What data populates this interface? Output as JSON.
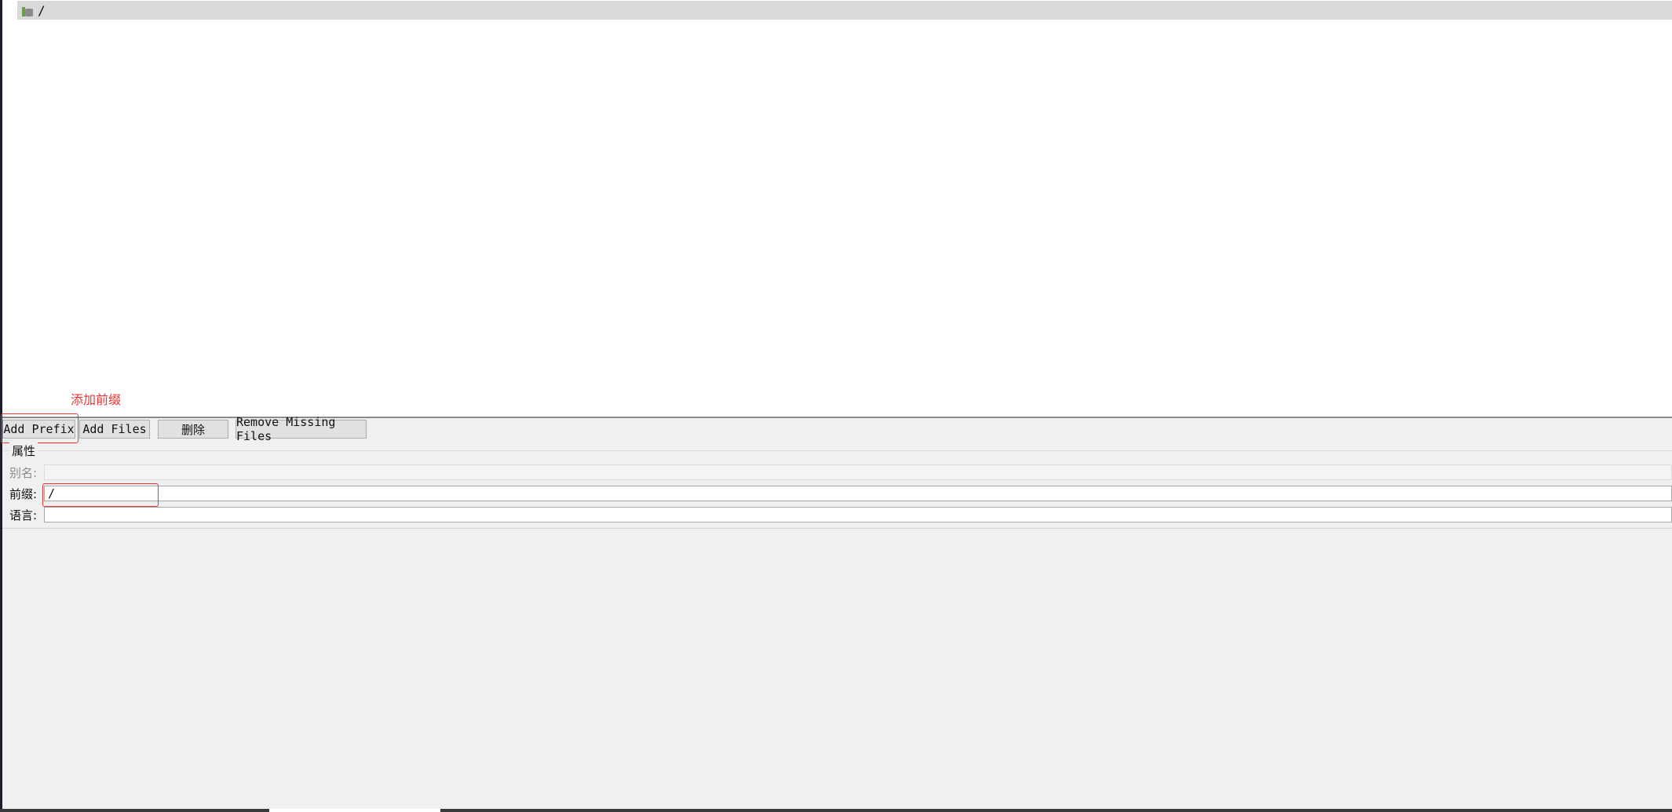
{
  "tree": {
    "root_label": "/",
    "root_icon": "resource-folder-icon"
  },
  "annotation": {
    "text": "添加前缀",
    "color": "#ee3333"
  },
  "toolbar": {
    "add_prefix": "Add Prefix",
    "add_files": "Add Files",
    "delete": "删除",
    "remove_missing_files": "Remove Missing Files"
  },
  "properties": {
    "group_title": "属性",
    "alias_label": "别名:",
    "alias_value": "",
    "prefix_label": "前缀:",
    "prefix_value": "/",
    "language_label": "语言:",
    "language_value": ""
  },
  "colors": {
    "highlight": "#ee3333",
    "panel_bg": "#f0f0f0",
    "header_bg": "#d9d9d9"
  }
}
